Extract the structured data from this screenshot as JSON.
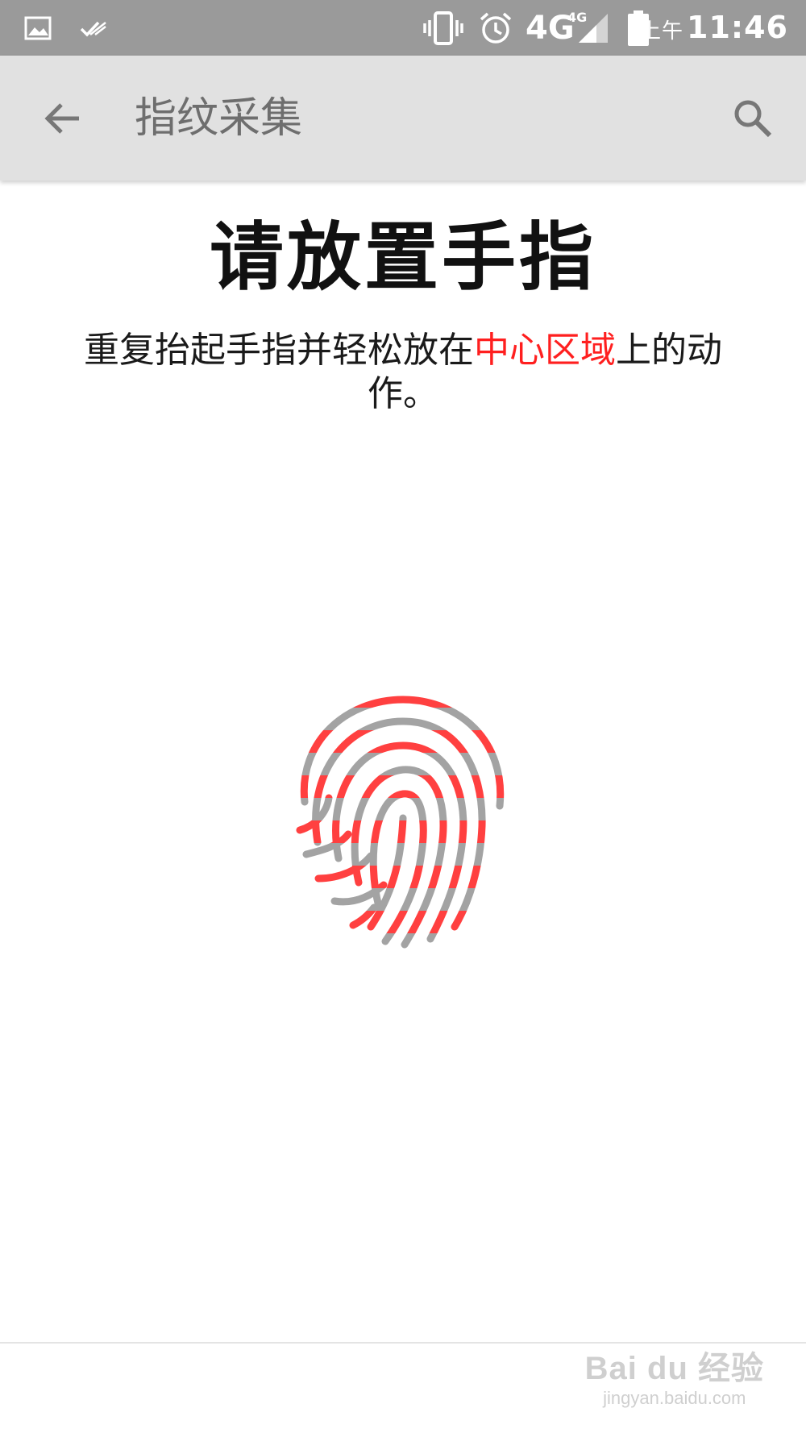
{
  "status_bar": {
    "time_period": "上午",
    "time": "11:46",
    "network": "4G",
    "network_small": "4G",
    "icons": [
      "gallery-icon",
      "check-icon",
      "vibrate-icon",
      "alarm-icon",
      "signal-icon",
      "battery-icon"
    ]
  },
  "app_bar": {
    "title": "指纹采集",
    "back_icon": "arrow-left-icon",
    "search_icon": "search-icon"
  },
  "main": {
    "heading": "请放置手指",
    "instruction_before": "重复抬起手指并轻松放在",
    "instruction_highlight": "中心区域",
    "instruction_after": "上的动作。",
    "highlight_color": "#ff1f1f",
    "fingerprint_icon": "fingerprint-icon"
  },
  "watermark": {
    "logo": "Bai  du 经验",
    "url": "jingyan.baidu.com"
  },
  "colors": {
    "status_bar": "#9a9a9a",
    "app_bar": "#e1e1e1",
    "fingerprint_progress": "#ff4040",
    "fingerprint_pending": "#a3a3a3"
  }
}
